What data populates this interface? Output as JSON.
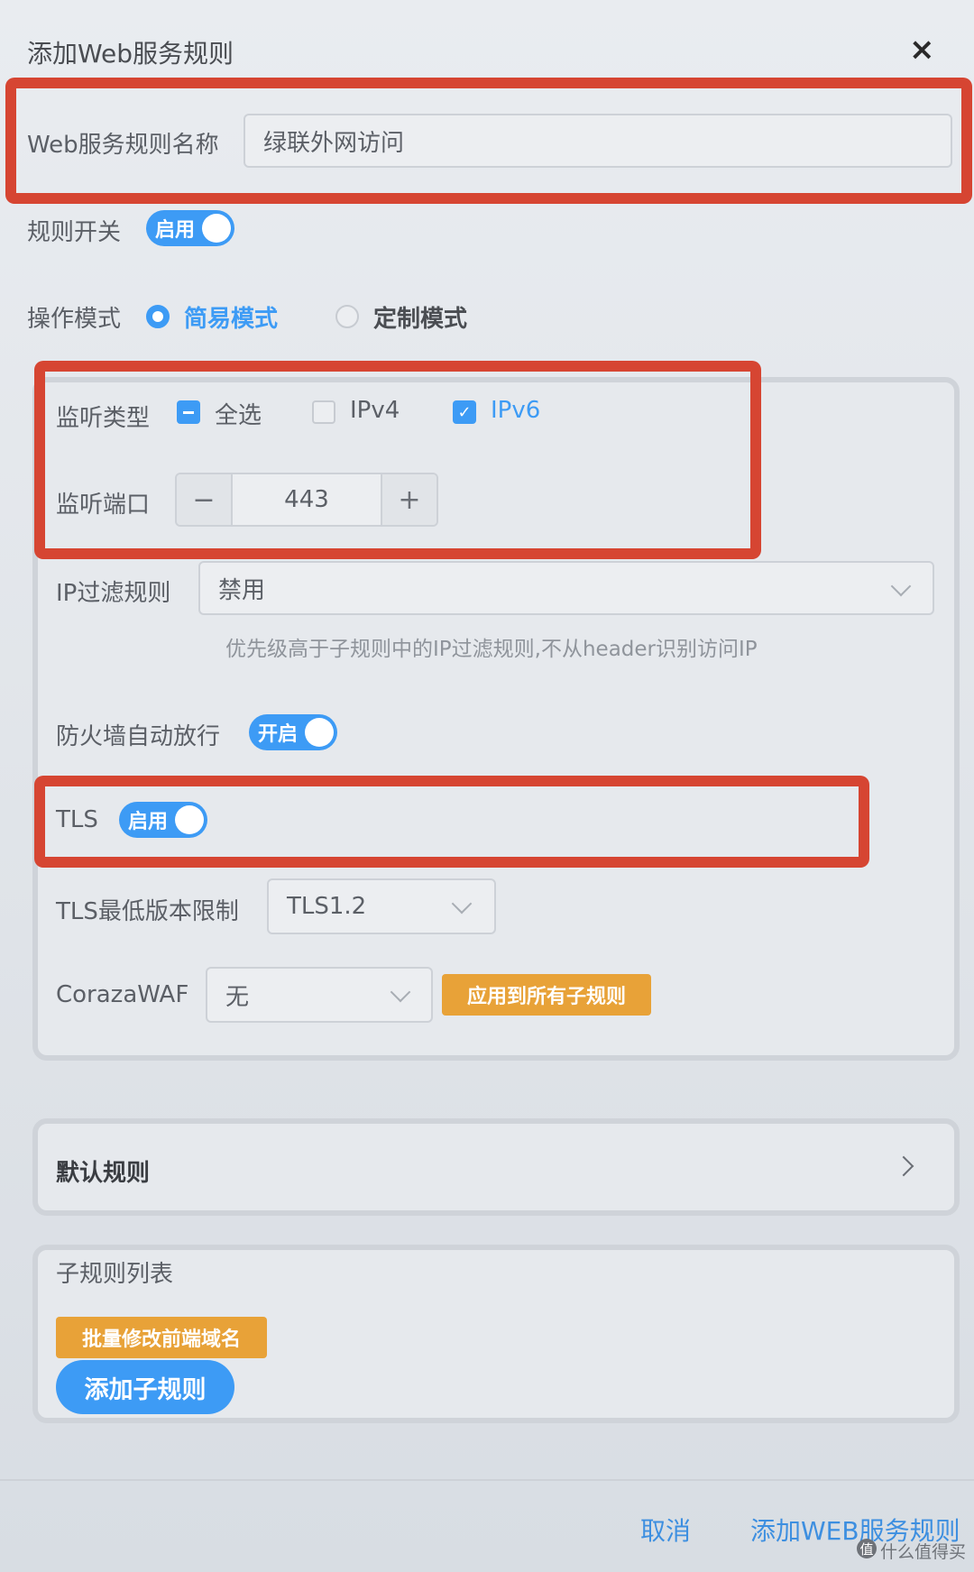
{
  "dialog": {
    "title": "添加Web服务规则",
    "close": "×"
  },
  "rule_name": {
    "label": "Web服务规则名称",
    "value": "绿联外网访问"
  },
  "rule_switch": {
    "label": "规则开关",
    "state": "启用"
  },
  "mode": {
    "label": "操作模式",
    "options": [
      "简易模式",
      "定制模式"
    ],
    "selected": "简易模式"
  },
  "listen": {
    "type_label": "监听类型",
    "select_all": "全选",
    "ipv4": "IPv4",
    "ipv6": "IPv6",
    "port_label": "监听端口",
    "port_value": "443",
    "minus": "−",
    "plus": "+"
  },
  "ip_filter": {
    "label": "IP过滤规则",
    "value": "禁用",
    "hint": "优先级高于子规则中的IP过滤规则,不从header识别访问IP"
  },
  "firewall": {
    "label": "防火墙自动放行",
    "state": "开启"
  },
  "tls": {
    "label": "TLS",
    "state": "启用"
  },
  "tls_min": {
    "label": "TLS最低版本限制",
    "value": "TLS1.2"
  },
  "waf": {
    "label": "CorazaWAF",
    "value": "无",
    "apply_button": "应用到所有子规则"
  },
  "default_rule": {
    "label": "默认规则"
  },
  "subrules": {
    "label": "子规则列表",
    "batch_button": "批量修改前端域名",
    "add_button": "添加子规则"
  },
  "footer": {
    "cancel": "取消",
    "submit": "添加WEB服务规则"
  },
  "watermark": "值 什么值得买",
  "colors": {
    "accent": "#3d9bf5",
    "highlight": "#d64532",
    "orange": "#e8a238"
  }
}
